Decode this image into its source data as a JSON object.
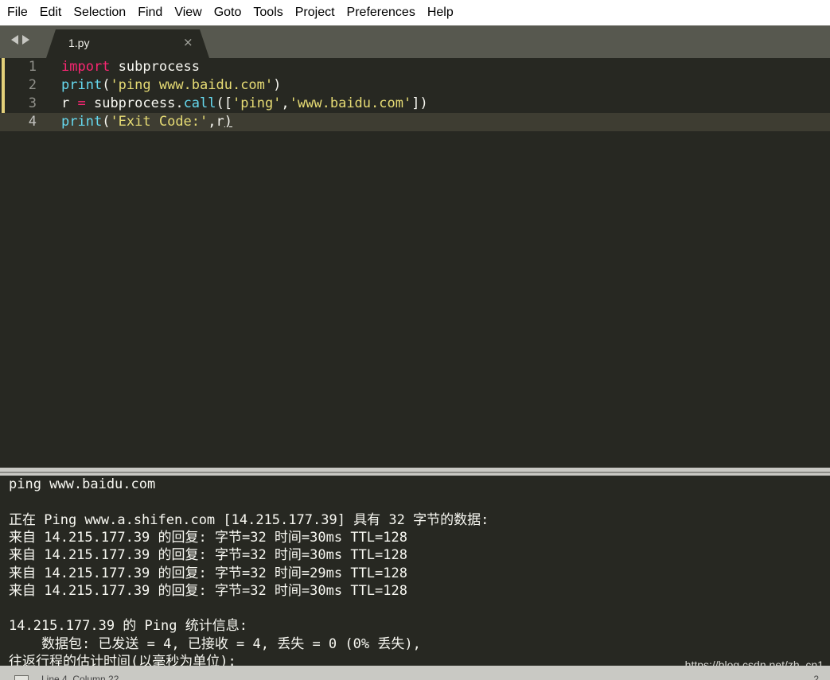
{
  "menu": {
    "items": [
      "File",
      "Edit",
      "Selection",
      "Find",
      "View",
      "Goto",
      "Tools",
      "Project",
      "Preferences",
      "Help"
    ]
  },
  "tab": {
    "title": "1.py",
    "close": "×"
  },
  "editor": {
    "lines": [
      {
        "number": "1",
        "tokens": [
          [
            "import",
            "kw"
          ],
          [
            " subprocess",
            "pl"
          ]
        ]
      },
      {
        "number": "2",
        "tokens": [
          [
            "print",
            "fn"
          ],
          [
            "(",
            "pl"
          ],
          [
            "'ping www.baidu.com'",
            "str"
          ],
          [
            ")",
            "pl"
          ]
        ]
      },
      {
        "number": "3",
        "tokens": [
          [
            "r ",
            "pl"
          ],
          [
            "=",
            "op"
          ],
          [
            " subprocess.",
            "pl"
          ],
          [
            "call",
            "fn"
          ],
          [
            "([",
            "pl"
          ],
          [
            "'ping'",
            "str"
          ],
          [
            ",",
            "pl"
          ],
          [
            "'www.baidu.com'",
            "str"
          ],
          [
            "])",
            "pl"
          ]
        ]
      },
      {
        "number": "4",
        "tokens": [
          [
            "print",
            "fn"
          ],
          [
            "(",
            "pl"
          ],
          [
            "'Exit Code:'",
            "str"
          ],
          [
            ",r",
            "pl"
          ],
          [
            ")",
            "pl"
          ]
        ]
      }
    ]
  },
  "output": {
    "lines": [
      "ping www.baidu.com",
      "",
      "正在 Ping www.a.shifen.com [14.215.177.39] 具有 32 字节的数据:",
      "来自 14.215.177.39 的回复: 字节=32 时间=30ms TTL=128",
      "来自 14.215.177.39 的回复: 字节=32 时间=30ms TTL=128",
      "来自 14.215.177.39 的回复: 字节=32 时间=29ms TTL=128",
      "来自 14.215.177.39 的回复: 字节=32 时间=30ms TTL=128",
      "",
      "14.215.177.39 的 Ping 统计信息:",
      "    数据包: 已发送 = 4, 已接收 = 4, 丢失 = 0 (0% 丢失),",
      "往返行程的估计时间(以毫秒为单位):"
    ]
  },
  "watermark": "https://blog.csdn.net/zh_cn1",
  "status": {
    "position": "Line 4, Column 22",
    "right": "2"
  },
  "colors": {
    "background": "#272822",
    "keyword": "#f92672",
    "function": "#66d9ef",
    "string": "#e6db74",
    "text": "#f8f8f2"
  }
}
